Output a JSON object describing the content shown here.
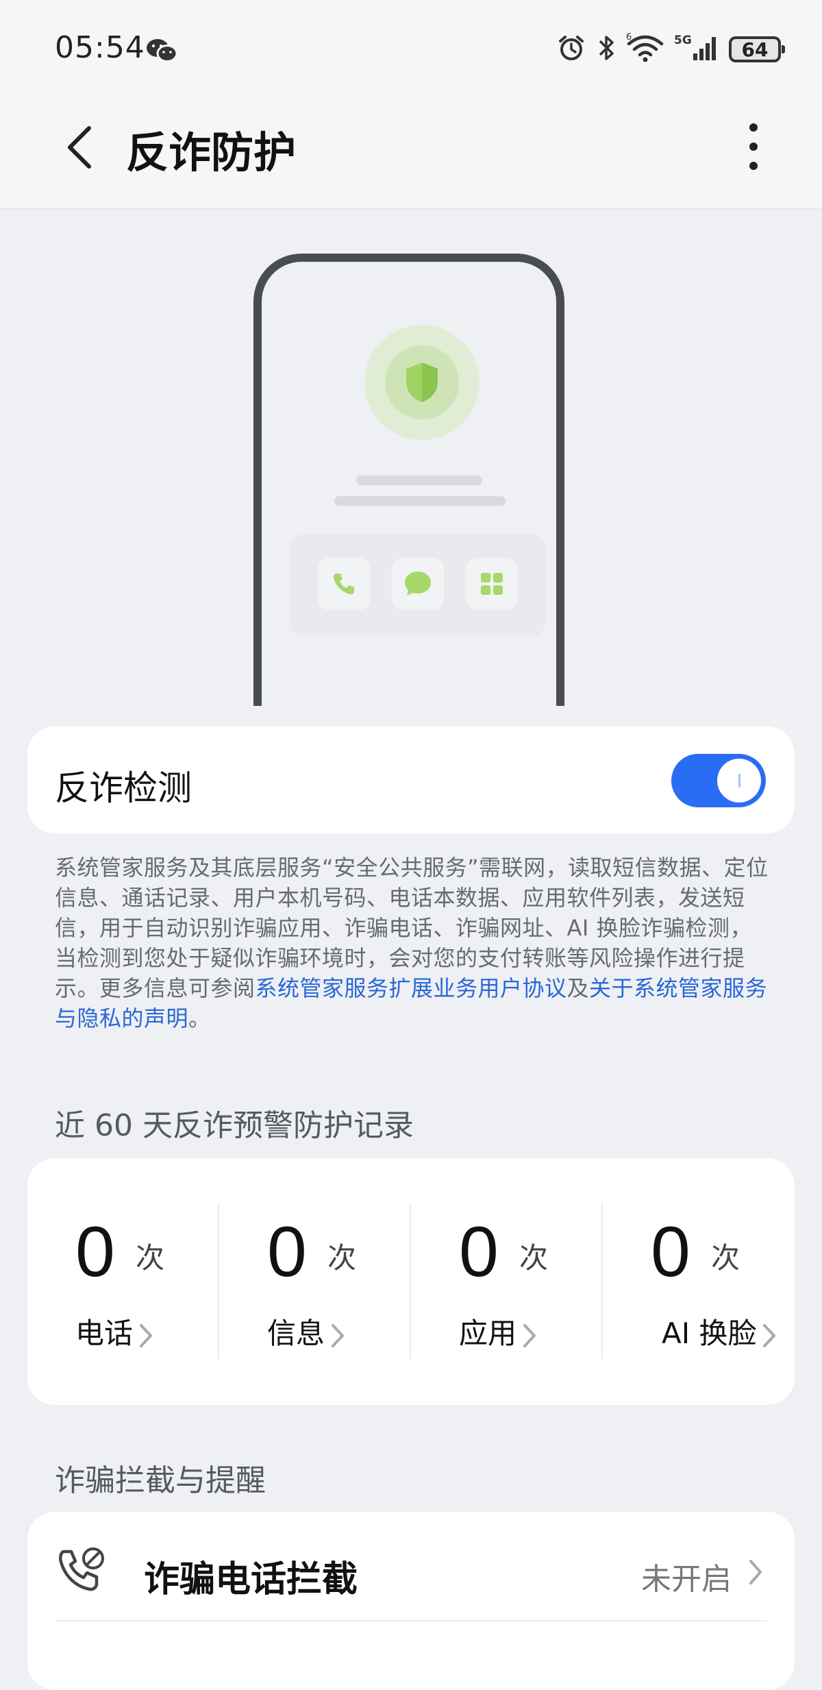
{
  "status_bar": {
    "time": "05:54",
    "battery": "64",
    "icons": [
      "wechat-icon",
      "alarm-icon",
      "bluetooth-icon",
      "wifi-icon",
      "5g-signal-icon",
      "battery-icon"
    ],
    "network_label": "5G",
    "wifi_label": "6"
  },
  "header": {
    "title": "反诈防护",
    "back_icon": "chevron-left-icon",
    "more_icon": "more-vertical-icon"
  },
  "hero": {
    "icons": [
      "shield-icon",
      "phone-icon",
      "message-icon",
      "apps-icon"
    ]
  },
  "detection": {
    "label": "反诈检测",
    "enabled": true,
    "toggle_color": "#2a6df5"
  },
  "description": {
    "text": "系统管家服务及其底层服务“安全公共服务”需联网，读取短信数据、定位信息、通话记录、用户本机号码、电话本数据、应用软件列表，发送短信，用于自动识别诈骗应用、诈骗电话、诈骗网址、AI 换脸诈骗检测，当检测到您处于疑似诈骗环境时，会对您的支付转账等风险操作进行提示。更多信息可参阅",
    "link1": "系统管家服务扩展业务用户协议",
    "joiner": "及",
    "link2": "关于系统管家服务与隐私的声明",
    "end": "。",
    "link_color": "#2a66d8"
  },
  "records": {
    "title": "近 60 天反诈预警防护记录",
    "items": [
      {
        "count": "0",
        "unit": "次",
        "label": "电话"
      },
      {
        "count": "0",
        "unit": "次",
        "label": "信息"
      },
      {
        "count": "0",
        "unit": "次",
        "label": "应用"
      },
      {
        "count": "0",
        "unit": "次",
        "label": "AI 换脸"
      }
    ]
  },
  "interception": {
    "title": "诈骗拦截与提醒",
    "items": [
      {
        "icon": "phone-block-icon",
        "label": "诈骗电话拦截",
        "value": "未开启"
      }
    ]
  }
}
